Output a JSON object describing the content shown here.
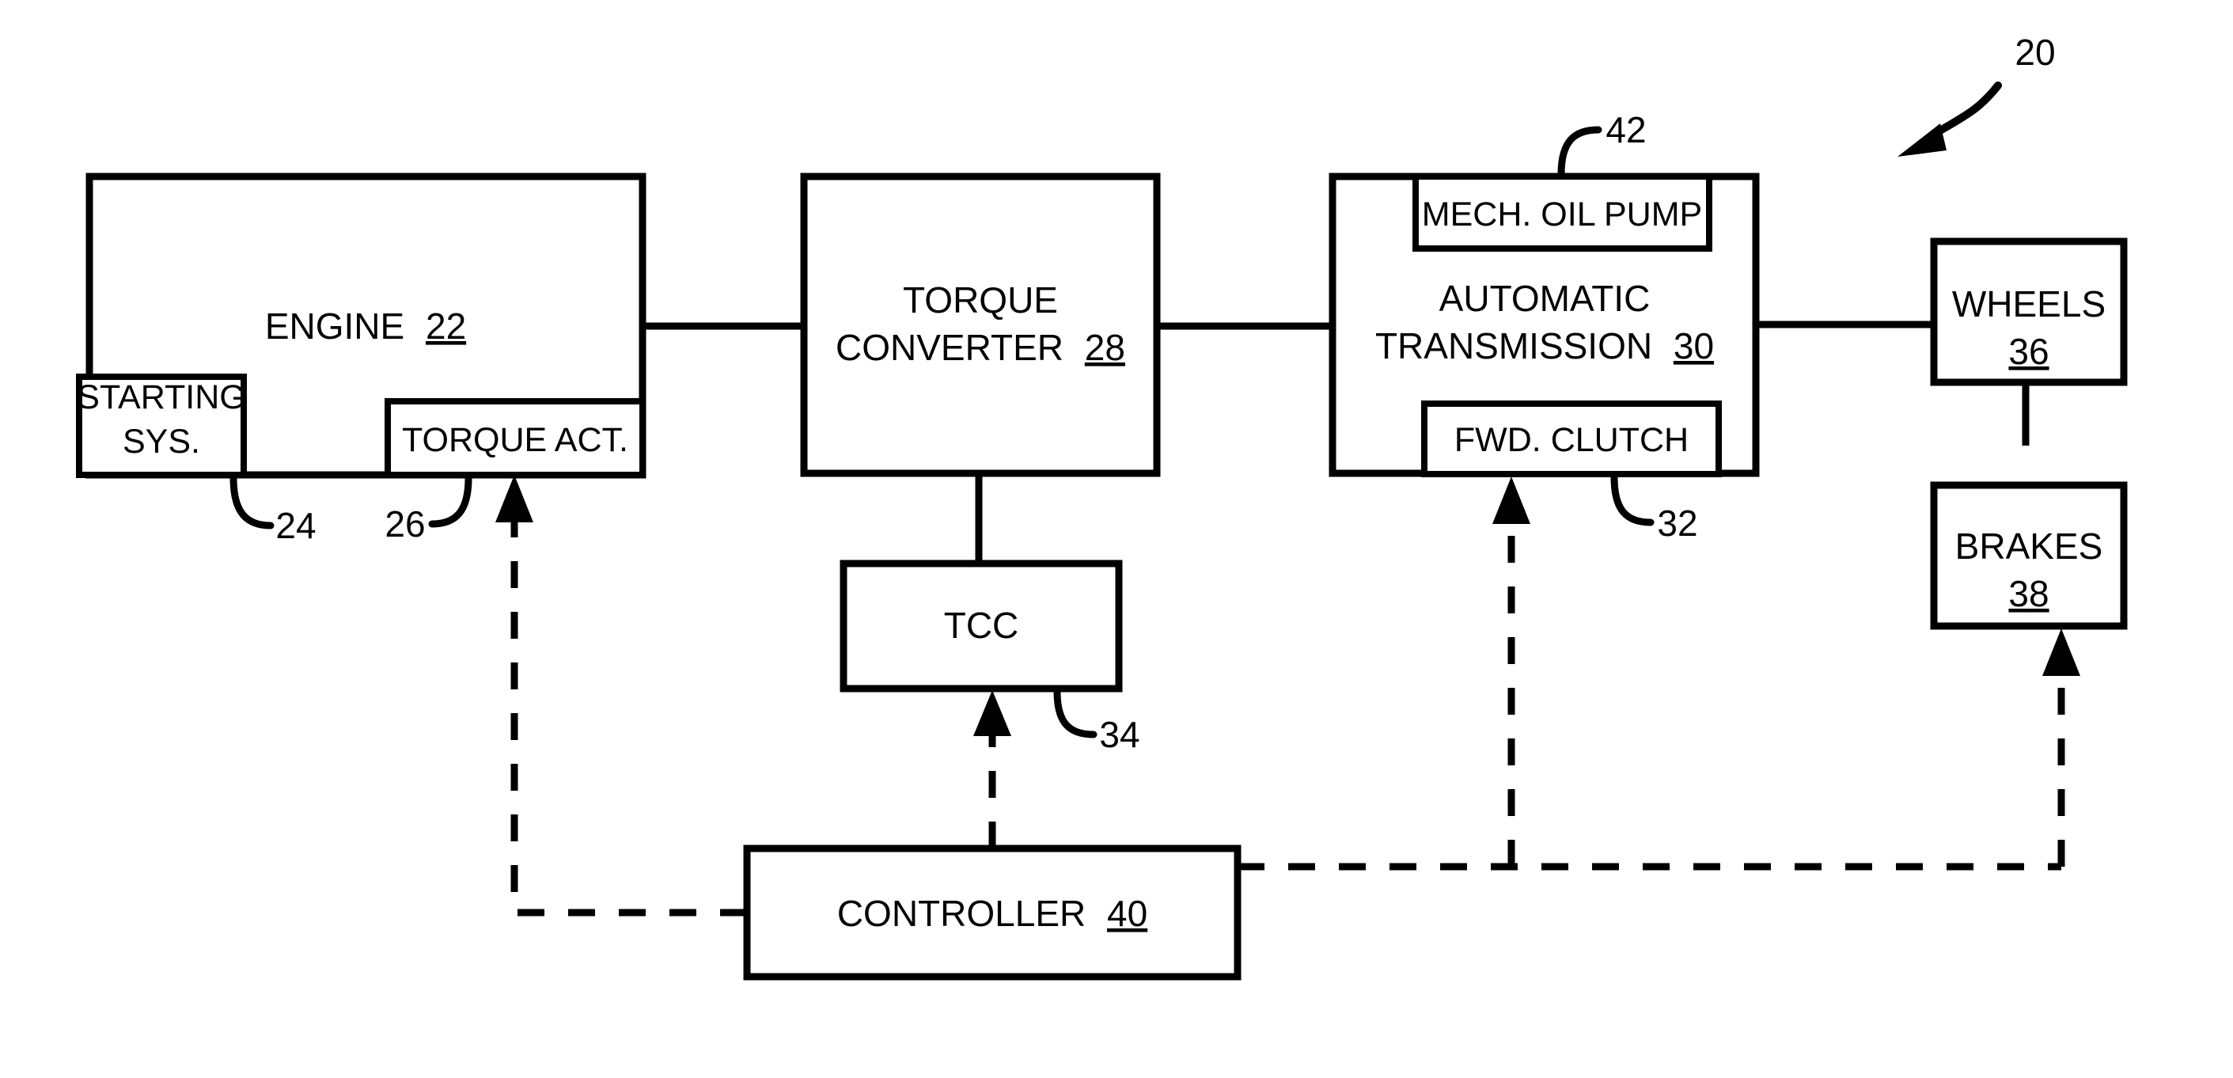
{
  "figure": {
    "reference_label": "20",
    "type": "vehicle powertrain block diagram"
  },
  "blocks": {
    "engine": {
      "label": "ENGINE",
      "ref": "22"
    },
    "starting_system": {
      "label": "STARTING",
      "label_line2": "SYS.",
      "ref": "24"
    },
    "torque_actuator": {
      "label": "TORQUE ACT.",
      "ref": "26"
    },
    "torque_converter": {
      "label_line1": "TORQUE",
      "label_line2": "CONVERTER",
      "ref": "28"
    },
    "tcc": {
      "label": "TCC",
      "ref": "34"
    },
    "automatic_transmission": {
      "label_line1": "AUTOMATIC",
      "label_line2": "TRANSMISSION",
      "ref": "30"
    },
    "mech_oil_pump": {
      "label": "MECH. OIL PUMP",
      "ref": "42"
    },
    "fwd_clutch": {
      "label": "FWD. CLUTCH",
      "ref": "32"
    },
    "wheels": {
      "label": "WHEELS",
      "ref": "36"
    },
    "brakes": {
      "label": "BRAKES",
      "ref": "38"
    },
    "controller": {
      "label": "CONTROLLER",
      "ref": "40"
    }
  },
  "connections": {
    "engine_to_torque_converter": "solid mechanical link",
    "torque_converter_to_transmission": "solid mechanical link",
    "transmission_to_wheels": "solid mechanical link",
    "wheels_to_brakes": "solid mechanical link",
    "torque_converter_to_tcc": "solid link",
    "controller_to_torque_actuator": "dashed control signal",
    "controller_to_tcc": "dashed control signal",
    "controller_to_fwd_clutch": "dashed control signal",
    "controller_to_brakes": "dashed control signal"
  }
}
